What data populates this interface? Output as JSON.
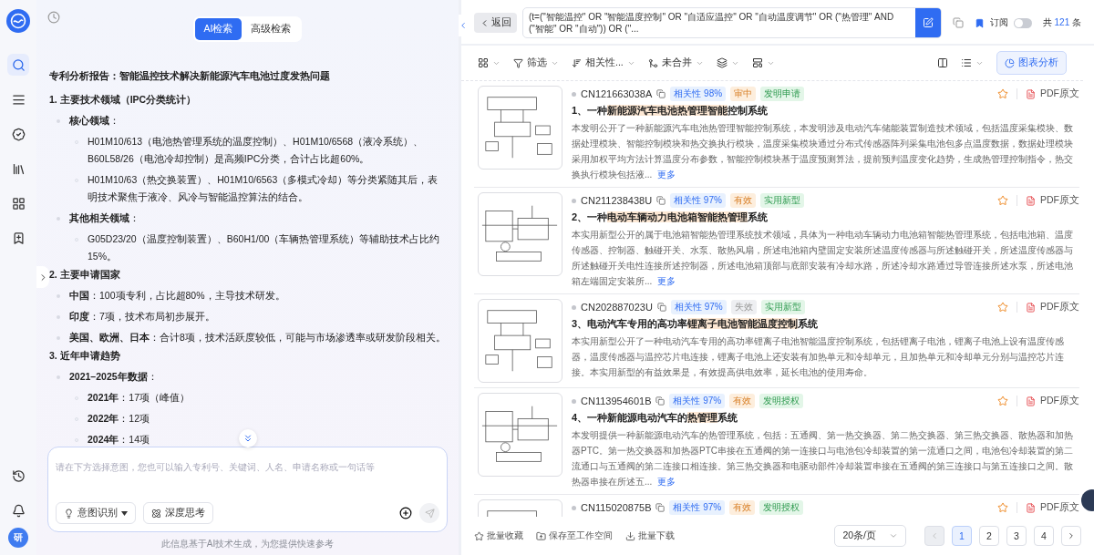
{
  "sidebar": {
    "items": [
      {
        "kind": "search",
        "selected": true
      },
      {
        "kind": "lines",
        "selected": false
      },
      {
        "kind": "check",
        "selected": false
      },
      {
        "kind": "book",
        "selected": false
      },
      {
        "kind": "apps",
        "selected": false
      },
      {
        "kind": "bookmark",
        "selected": false
      }
    ],
    "bottom": [
      {
        "kind": "history"
      },
      {
        "kind": "bell"
      }
    ],
    "avatar": "研"
  },
  "search_tabs": [
    {
      "label": "AI检索",
      "selected": true
    },
    {
      "label": "高级检索",
      "selected": false
    }
  ],
  "report": {
    "title": "专利分析报告：智能温控技术解决新能源汽车电池过度发热问题",
    "sections": [
      {
        "heading": "1. 主要技术领域（IPC分类统计）",
        "items": [
          {
            "text": "**核心领域**：",
            "children": [
              {
                "text": "H01M10/613（电池热管理系统的温度控制）、H01M10/6568（液冷系统）、B60L58/26（电池冷却控制）是高频IPC分类，合计占比超60%。"
              },
              {
                "text": "H01M10/63（热交换装置）、H01M10/6563（多模式冷却）等分类紧随其后，表明技术聚焦于液冷、风冷与智能温控算法的结合。"
              }
            ]
          },
          {
            "text": "**其他相关领域**：",
            "children": [
              {
                "text": "G05D23/20（温度控制装置）、B60H1/00（车辆热管理系统）等辅助技术占比约15%。"
              }
            ]
          }
        ]
      },
      {
        "heading": "2. 主要申请国家",
        "items": [
          {
            "text": "**中国**：100项专利，占比超80%，主导技术研发。"
          },
          {
            "text": "**印度**：7项，技术布局初步展开。"
          },
          {
            "text": "**美国、欧洲、日本**：合计8项，技术活跃度较低，可能与市场渗透率或研发阶段相关。"
          }
        ]
      },
      {
        "heading": "3. 近年申请趋势",
        "items": [
          {
            "text": "**2021–2025年数据**：",
            "children": [
              {
                "text": "**2021年**：17项（峰值）"
              },
              {
                "text": "**2022年**：12项"
              },
              {
                "text": "**2024年**：14项"
              }
            ]
          }
        ]
      }
    ]
  },
  "composer": {
    "placeholder": "请在下方选择意图，您也可以输入专利号、关键词、人名、申请名称或一句话等",
    "buttons": [
      {
        "label": "意图识别",
        "kind": "dropdown"
      },
      {
        "label": "深度思考",
        "kind": "toggle"
      }
    ]
  },
  "disclaimer": "此信息基于AI技术生成，为您提供快速参考",
  "back_button": "返回",
  "query": "(t=(\"智能温控\" OR \"智能温度控制\" OR \"自适应温控\" OR \"自动温度调节\" OR (\"热管理\" AND (\"智能\" OR \"自动\")) OR (\"...",
  "subscribe": {
    "label": "订阅",
    "on": false
  },
  "total": {
    "prefix": "共",
    "count": "121",
    "suffix": "条"
  },
  "toolbar": {
    "filters": [
      {
        "label": "筛选",
        "kind": "filter"
      },
      {
        "label": "相关性...",
        "kind": "sort"
      },
      {
        "label": "未合并",
        "kind": "merge"
      }
    ],
    "chart_button": "图表分析"
  },
  "results": [
    {
      "number": "CN121663038A",
      "relevance": "相关性 98%",
      "status": {
        "label": "审中",
        "kind": "active"
      },
      "type": "发明申请",
      "title": [
        {
          "text": "1、一种",
          "highlight": false
        },
        {
          "text": "新能源汽车电池热管理智能",
          "highlight": true
        },
        {
          "text": "控制系统",
          "highlight": false
        }
      ],
      "abstract": "本发明公开了一种新能源汽车电池热管理智能控制系统，本发明涉及电动汽车储能装置制造技术领域，包括温度采集模块、数据处理模块、智能控制模块和热交换执行模块，温度采集模块通过分布式传感器阵列采集电池包多点温度数据，数据处理模块采用加权平均方法计算温度分布参数，智能控制模块基于温度预测算法，提前预判温度变化趋势，生成热管理控制指令，热交换执行模块包括液...",
      "more": "更多",
      "pdf": "PDF原文"
    },
    {
      "number": "CN211238438U",
      "relevance": "相关性 97%",
      "status": {
        "label": "有效",
        "kind": "active"
      },
      "type": "实用新型",
      "title": [
        {
          "text": "2、一种",
          "highlight": false
        },
        {
          "text": "电动车辆动力电池箱智能热管理",
          "highlight": true
        },
        {
          "text": "系统",
          "highlight": false
        }
      ],
      "abstract": "本实用新型公开的属于电池箱智能热管理系统技术领域，具体为一种电动车辆动力电池箱智能热管理系统，包括电池箱、温度传感器、控制器、触碰开关、水泵、散热风扇，所述电池箱内壁固定安装所述温度传感器与所述触碰开关，所述温度传感器与所述触碰开关电性连接所述控制器，所述电池箱顶部与底部安装有冷却水路，所述冷却水路通过导管连接所述水泵，所述电池箱左端固定安装所...",
      "more": "更多",
      "pdf": "PDF原文"
    },
    {
      "number": "CN202887023U",
      "relevance": "相关性 97%",
      "status": {
        "label": "失效",
        "kind": "expired"
      },
      "type": "实用新型",
      "title": [
        {
          "text": "3、电动汽车专用的高功率",
          "highlight": false
        },
        {
          "text": "锂离子电池智能温度控制",
          "highlight": true
        },
        {
          "text": "系统",
          "highlight": false
        }
      ],
      "abstract": "本实用新型公开了一种电动汽车专用的高功率锂离子电池智能温度控制系统，包括锂离子电池，锂离子电池上设有温度传感器，温度传感器与温控芯片电连接，锂离子电池上还安装有加热单元和冷却单元，且加热单元和冷却单元分别与温控芯片连接。本实用新型的有益效果是，有效提高供电效率，延长电池的使用寿命。",
      "pdf": "PDF原文"
    },
    {
      "number": "CN113954601B",
      "relevance": "相关性 97%",
      "status": {
        "label": "有效",
        "kind": "active"
      },
      "type": "发明授权",
      "title": [
        {
          "text": "4、一种新能源电动汽车的",
          "highlight": false
        },
        {
          "text": "热管理",
          "highlight": true
        },
        {
          "text": "系统",
          "highlight": false
        }
      ],
      "abstract": "本发明提供一种新能源电动汽车的热管理系统，包括：五通阀、第一热交换器、第二热交换器、第三热交换器、散热器和加热器PTC。第一热交换器和加热器PTC串接在五通阀的第一连接口与电池包冷却装置的第一流通口之间，电池包冷却装置的第二流通口与五通阀的第二连接口相连接。第三热交换器和电驱动部件冷却装置串接在五通阀的第三连接口与第五连接口之间。散热器串接在所述五...",
      "more": "更多",
      "pdf": "PDF原文"
    },
    {
      "number": "CN115020875B",
      "relevance": "相关性 97%",
      "status": {
        "label": "有效",
        "kind": "active"
      },
      "type": "发明授权",
      "pdf": "PDF原文"
    }
  ],
  "footer_actions": [
    {
      "label": "批量收藏",
      "kind": "collect"
    },
    {
      "label": "保存至工作空间",
      "kind": "save"
    },
    {
      "label": "批量下载",
      "kind": "download"
    }
  ],
  "page_size": "20条/页",
  "pages": [
    {
      "label": "1",
      "selected": true
    },
    {
      "label": "2",
      "selected": false
    },
    {
      "label": "3",
      "selected": false
    },
    {
      "label": "4",
      "selected": false
    }
  ]
}
